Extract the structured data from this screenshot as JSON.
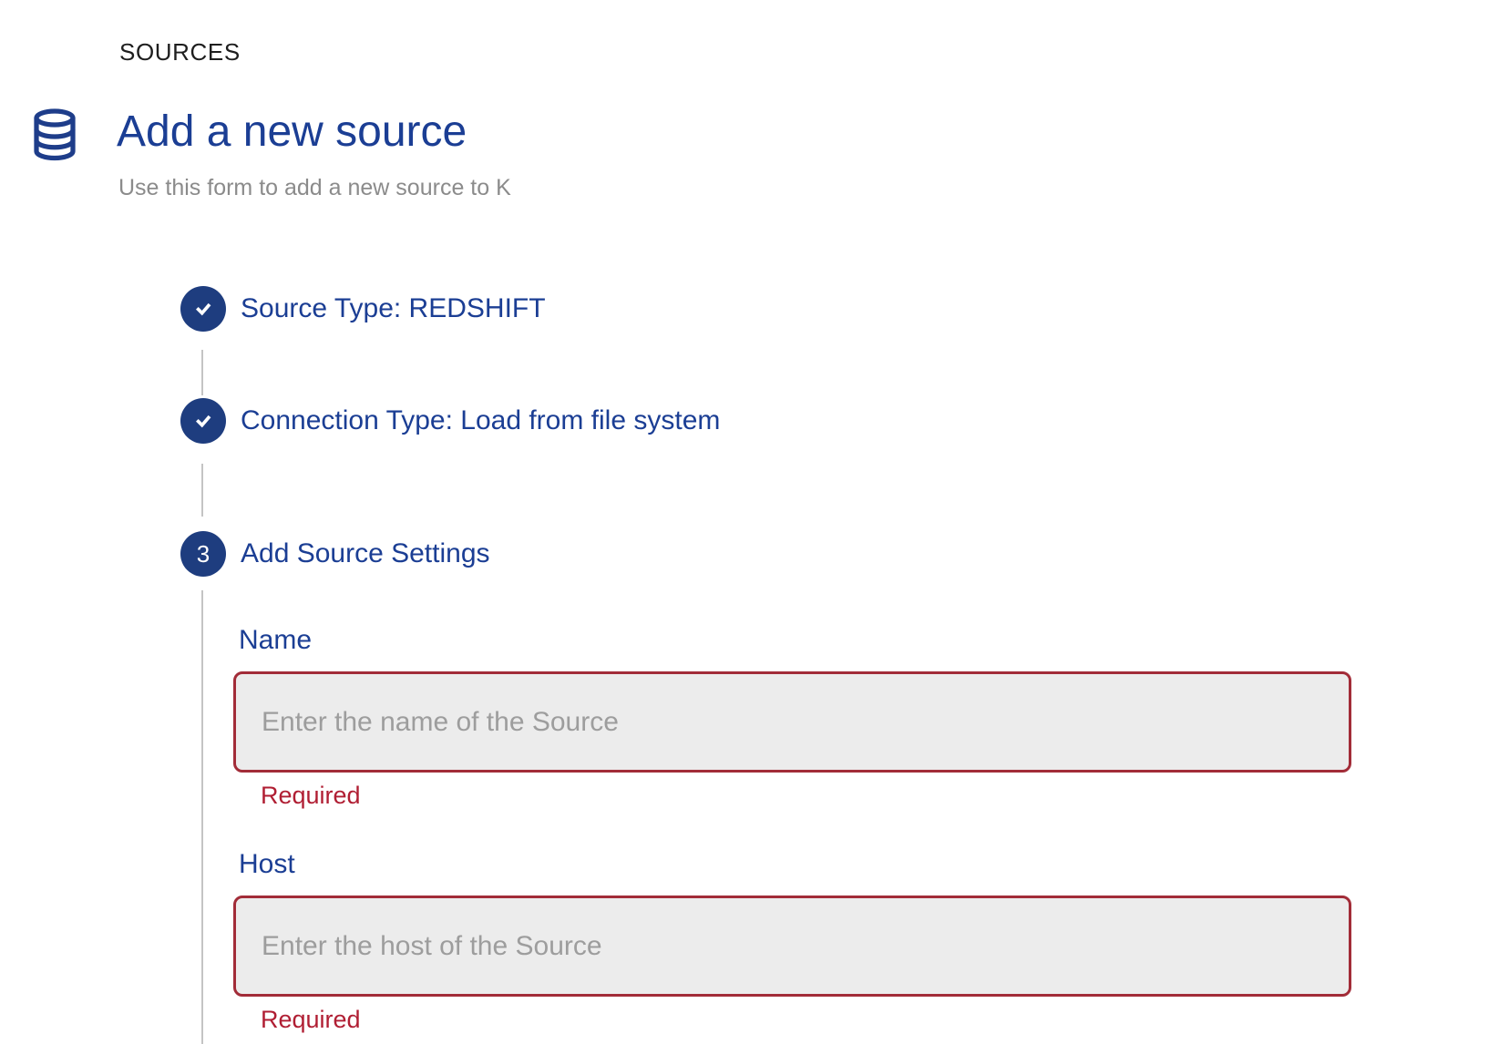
{
  "page": {
    "eyebrow": "SOURCES",
    "title": "Add a new source",
    "subtitle": "Use this form to add a new source to K"
  },
  "colors": {
    "primary_blue": "#1b3e94",
    "step_circle_blue": "#1e3d7f",
    "icon_blue": "#1e3d8a",
    "error_text_red": "#b01e33",
    "input_border_red": "#a22c38",
    "input_background": "#ececec",
    "placeholder_gray": "#9d9d9d",
    "subtitle_gray": "#8b8b8b",
    "connector_gray": "#c4c4c4"
  },
  "icons": {
    "header_icon": "database-icon",
    "completed_step_icon": "check-icon"
  },
  "stepper": {
    "steps": [
      {
        "label": "Source Type: REDSHIFT",
        "state": "completed"
      },
      {
        "label": "Connection Type: Load from file system",
        "state": "completed"
      },
      {
        "label": "Add Source Settings",
        "state": "active",
        "number": "3"
      }
    ]
  },
  "form": {
    "fields": [
      {
        "label": "Name",
        "value": "",
        "placeholder": "Enter the name of the Source",
        "helper": "Required"
      },
      {
        "label": "Host",
        "value": "",
        "placeholder": "Enter the host of the Source",
        "helper": "Required"
      }
    ]
  }
}
